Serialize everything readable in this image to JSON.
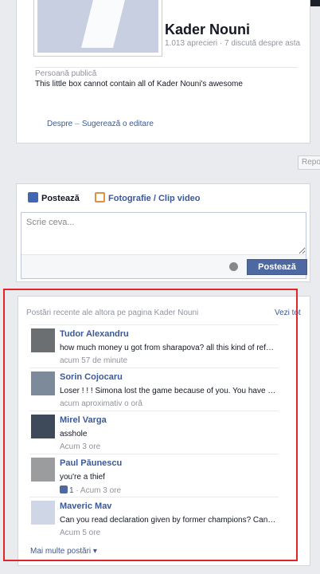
{
  "profile": {
    "name": "Kader Nouni",
    "stats": "1.013 aprecieri · 7 discută despre asta",
    "category": "Persoană publică",
    "about": "This little box cannot contain all of Kader Nouni's awesome",
    "links": {
      "about": "Despre",
      "separator": "–",
      "suggest": "Sugerează o editare"
    }
  },
  "report_button": "Repo",
  "composer": {
    "tab_status": "Postează",
    "tab_photo": "Fotografie / Clip video",
    "placeholder": "Scrie ceva...",
    "post_button": "Postează"
  },
  "recent": {
    "header": "Postări recente ale altora pe pagina Kader Nouni",
    "see_all": "Vezi tot",
    "more": "Mai multe postări ▾",
    "posts": [
      {
        "name": "Tudor Alexandru",
        "text": "how much money u got from sharapova? all this kind of refer...",
        "time": "acum 57 de minute"
      },
      {
        "name": "Sorin Cojocaru",
        "text": "Loser ! ! ! Simona lost the game because of you. You have t...",
        "time": "acum aproximativ o oră"
      },
      {
        "name": "Mirel Varga",
        "text": "asshole",
        "time": "Acum 3 ore"
      },
      {
        "name": "Paul Păunescu",
        "text": "you're a thief",
        "likes": "1",
        "time": "· Acum 3 ore"
      },
      {
        "name": "Maveric Mav",
        "text": "Can you read declaration given by former champions? Can y...",
        "time": "Acum 5 ore"
      }
    ]
  }
}
